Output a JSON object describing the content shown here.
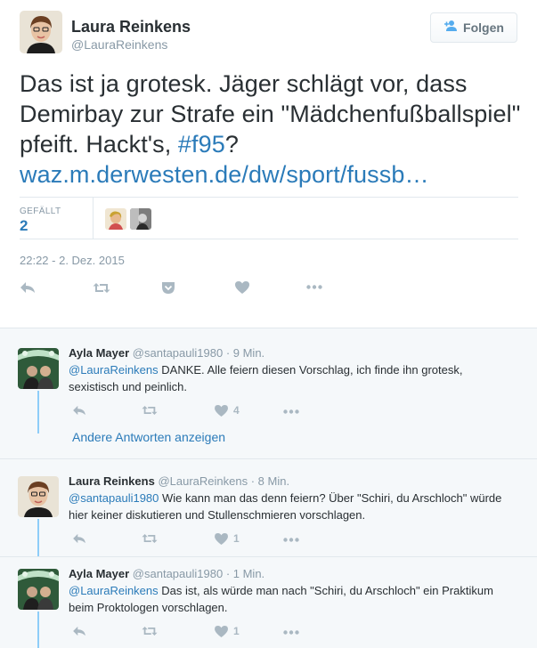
{
  "main_tweet": {
    "author_name": "Laura Reinkens",
    "author_handle": "@LauraReinkens",
    "follow_label": "Folgen",
    "text_plain": "Das ist ja grotesk. Jäger schlägt vor, dass Demirbay zur Strafe ein \"Mädchenfußballspiel\" pfeift. Hackt's, ",
    "hashtag": "#f95",
    "text_after_hashtag": "?",
    "link_text": "waz.m.derwesten.de/dw/sport/fussb…",
    "likes_label": "GEFÄLLT",
    "likes_count": "2",
    "timestamp": "22:22 - 2. Dez. 2015",
    "icons": [
      "reply-icon",
      "retweet-icon",
      "pocket-icon",
      "heart-icon",
      "more-icon"
    ]
  },
  "replies": [
    {
      "name": "Ayla Mayer",
      "handle": "@santapauli1980",
      "time": "· 9 Min.",
      "mention": "@LauraReinkens",
      "text": " DANKE. Alle feiern diesen Vorschlag, ich finde ihn grotesk, sexistisch und peinlich.",
      "like_count": "4"
    },
    {
      "name": "Laura Reinkens",
      "handle": "@LauraReinkens",
      "time": "· 8 Min.",
      "mention": "@santapauli1980",
      "text": " Wie kann man das denn feiern? Über \"Schiri, du Arschloch\" würde hier keiner diskutieren und Stullenschmieren vorschlagen.",
      "like_count": "1"
    },
    {
      "name": "Ayla Mayer",
      "handle": "@santapauli1980",
      "time": "· 1 Min.",
      "mention": "@LauraReinkens",
      "text": " Das ist, als würde man nach \"Schiri, du Arschloch\" ein Praktikum beim Proktologen vorschlagen.",
      "like_count": "1"
    }
  ],
  "more_replies_label": "Andere Antworten anzeigen",
  "colors": {
    "link": "#2b7bb9",
    "muted": "#8899a6",
    "icon": "#aab8c2",
    "thread_line": "#8ecdf8",
    "reply_bg": "#f5f8fa"
  }
}
